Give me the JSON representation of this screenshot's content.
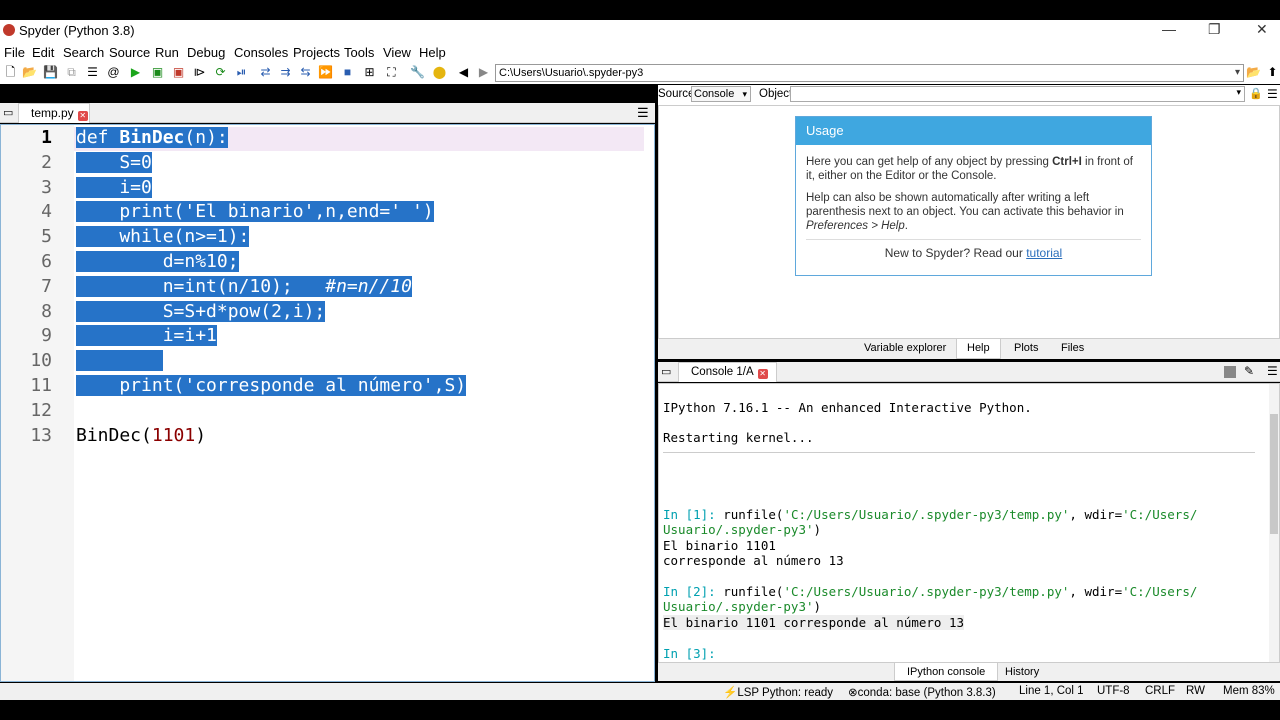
{
  "window": {
    "title": "Spyder (Python 3.8)",
    "minimize": "—",
    "restore": "❐",
    "close": "✕"
  },
  "menu": [
    "File",
    "Edit",
    "Search",
    "Source",
    "Run",
    "Debug",
    "Consoles",
    "Projects",
    "Tools",
    "View",
    "Help"
  ],
  "toolbar": {
    "path_value": "C:\\Users\\Usuario\\.spyder-py3"
  },
  "editor": {
    "file_path": "C:\\Users\\Usuario\\.spyder-py3\\temp.py",
    "tab_label": "temp.py",
    "lines": [
      {
        "n": "1",
        "text": "def BinDec(n):",
        "selected": true
      },
      {
        "n": "2",
        "text": "    S=0",
        "selected": true
      },
      {
        "n": "3",
        "text": "    i=0",
        "selected": true
      },
      {
        "n": "4",
        "text": "    print('El binario',n,end=' ')",
        "selected": true
      },
      {
        "n": "5",
        "text": "    while(n>=1):",
        "selected": true
      },
      {
        "n": "6",
        "text": "        d=n%10;",
        "selected": true
      },
      {
        "n": "7",
        "text": "        n=int(n/10);   #n=n//10",
        "selected": true
      },
      {
        "n": "8",
        "text": "        S=S+d*pow(2,i);",
        "selected": true
      },
      {
        "n": "9",
        "text": "        i=i+1",
        "selected": true
      },
      {
        "n": "10",
        "text": "        ",
        "selected": true
      },
      {
        "n": "11",
        "text": "    print('corresponde al número',S)",
        "selected": true
      },
      {
        "n": "12",
        "text": "",
        "selected": false
      },
      {
        "n": "13",
        "text": "BinDec(1101)",
        "selected": false
      }
    ]
  },
  "help": {
    "source_label": "Source",
    "source_value": "Console",
    "object_label": "Object",
    "usage_title": "Usage",
    "usage_p1_a": "Here you can get help of any object by pressing ",
    "usage_p1_key": "Ctrl+I",
    "usage_p1_b": " in front of it, either on the Editor or the Console.",
    "usage_p2_a": "Help can also be shown automatically after writing a left parenthesis next to an object. You can activate this behavior in ",
    "usage_p2_pref": "Preferences > Help",
    "usage_p2_b": ".",
    "usage_new_a": "New to Spyder? Read our ",
    "usage_new_link": "tutorial",
    "tabs": [
      "Variable explorer",
      "Help",
      "Plots",
      "Files"
    ]
  },
  "console": {
    "tab_label": "Console 1/A",
    "banner": "IPython 7.16.1 -- An enhanced Interactive Python.",
    "restart": "Restarting kernel...",
    "in1_prompt": "In [1]: ",
    "in1_cmd": "runfile(",
    "in1_s1": "'C:/Users/Usuario/.spyder-py3/temp.py'",
    "in1_mid": ", wdir=",
    "in1_s2a": "'C:/Users/",
    "in1_s2b": "Usuario/.spyder-py3'",
    "in1_end": ")",
    "out1_a": "El binario 1101",
    "out1_b": "corresponde al número 13",
    "in2_prompt": "In [2]: ",
    "out2": "El binario 1101 corresponde al número 13",
    "in3_prompt": "In [3]: ",
    "bottom_tabs": [
      "IPython console",
      "History"
    ]
  },
  "status": {
    "lsp": "LSP Python: ready",
    "conda": "conda: base (Python 3.8.3)",
    "position": "Line 1, Col 1",
    "encoding": "UTF-8",
    "eol": "CRLF",
    "mode": "RW",
    "mem": "Mem 83%"
  }
}
